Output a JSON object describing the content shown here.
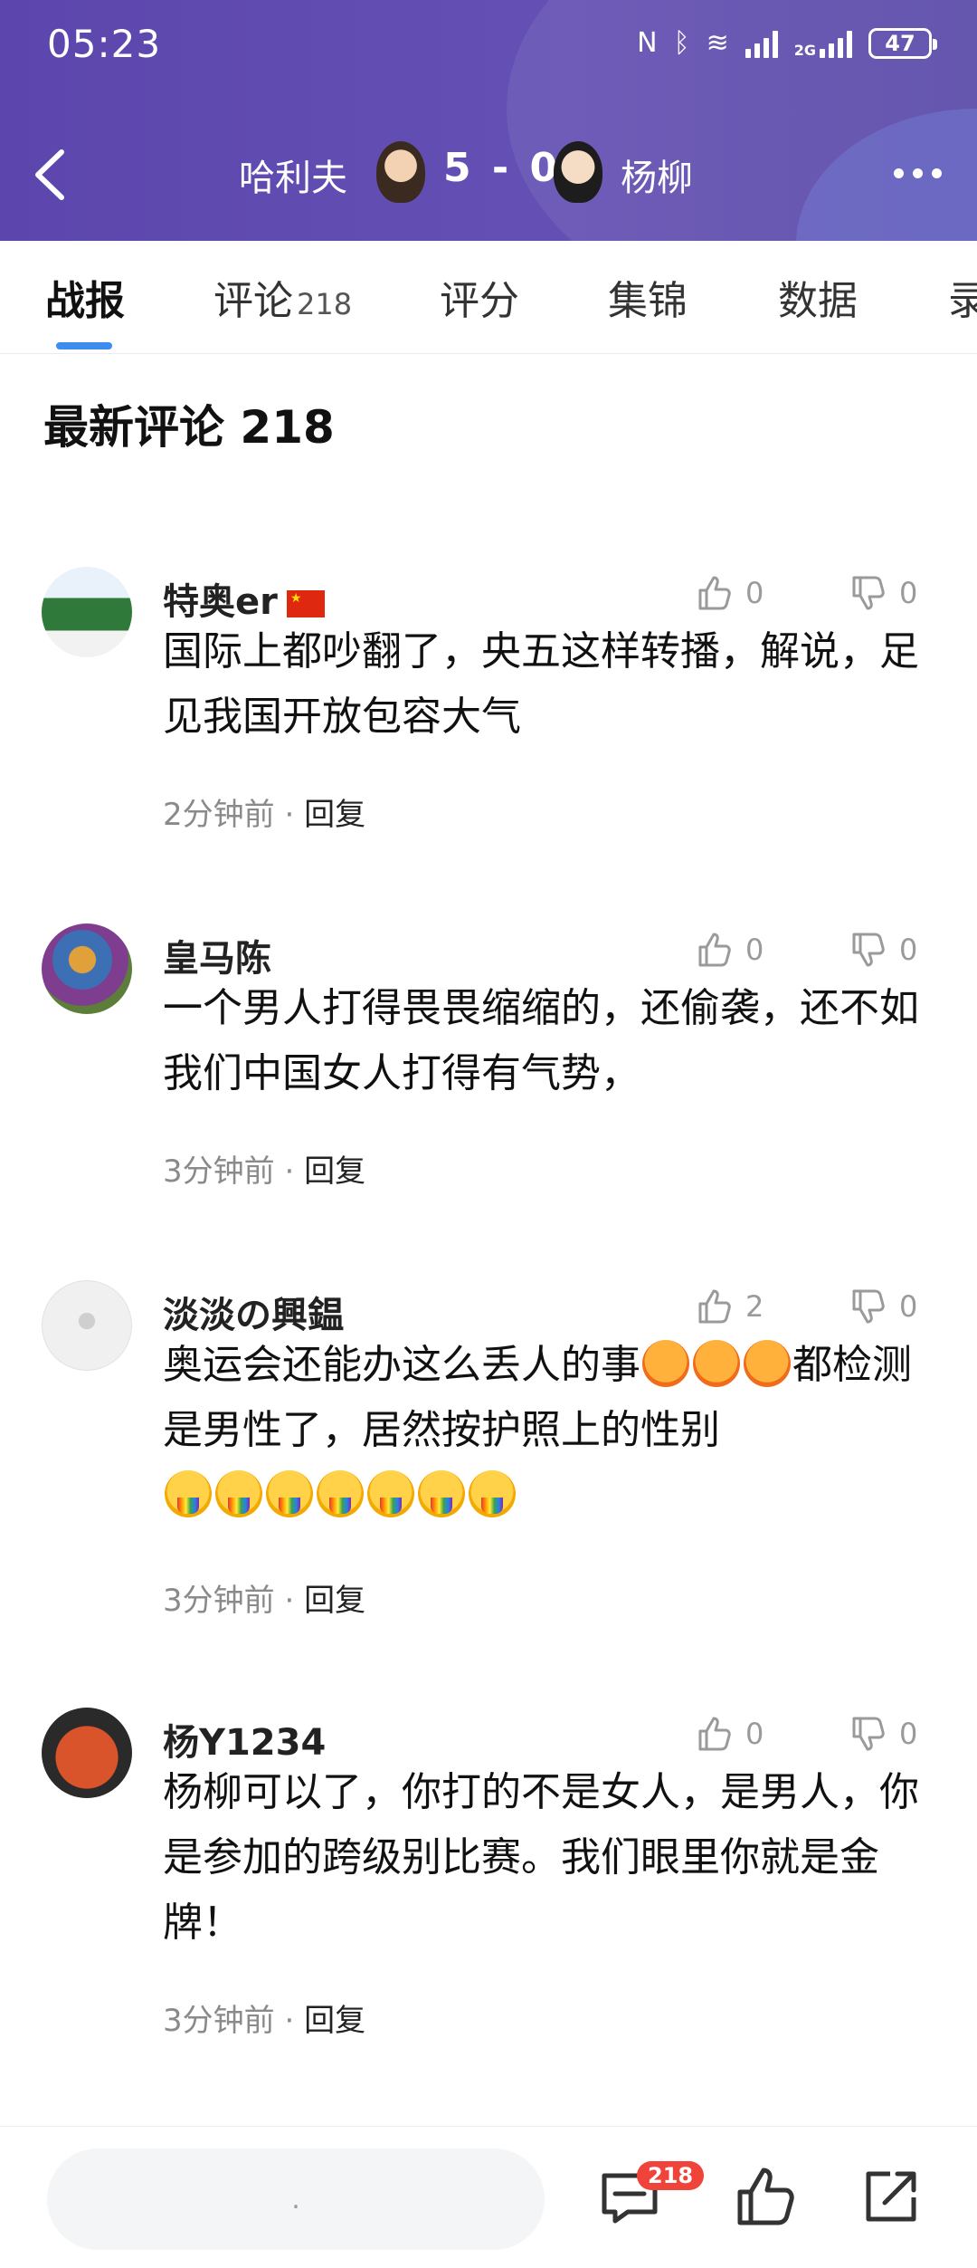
{
  "status_bar": {
    "time": "05:23",
    "network_1": "2G",
    "battery": "47"
  },
  "match": {
    "team_a": "哈利夫",
    "score": "5 - 0",
    "team_b": "杨柳"
  },
  "tabs": [
    {
      "label": "战报",
      "active": true
    },
    {
      "label": "评论",
      "count": "218",
      "active": false
    },
    {
      "label": "评分",
      "active": false
    },
    {
      "label": "集锦",
      "active": false
    },
    {
      "label": "数据",
      "active": false
    },
    {
      "label": "录",
      "active": false
    }
  ],
  "section": {
    "title": "最新评论 218"
  },
  "comments": [
    {
      "user": "特奥er",
      "flag": "cn-flag-icon",
      "text": "国际上都吵翻了，央五这样转播，解说，足见我国开放包容大气",
      "likes": "0",
      "dislikes": "0",
      "time": "2分钟前",
      "reply": "回复"
    },
    {
      "user": "皇马陈",
      "text": "一个男人打得畏畏缩缩的，还偷袭，还不如我们中国女人打得有气势，",
      "likes": "0",
      "dislikes": "0",
      "time": "3分钟前",
      "reply": "回复"
    },
    {
      "user": "淡淡の興鎾",
      "text_part1": "奥运会还能办这么丢人的事",
      "text_part2": "都检测是男性了，居然按护照上的性别",
      "likes": "2",
      "dislikes": "0",
      "time": "3分钟前",
      "reply": "回复"
    },
    {
      "user": "杨Y1234",
      "text": "杨柳可以了，你打的不是女人，是男人，你是参加的跨级别比赛。我们眼里你就是金牌！",
      "likes": "0",
      "dislikes": "0",
      "time": "3分钟前",
      "reply": "回复"
    }
  ],
  "bottom_bar": {
    "input_hint": ".",
    "comment_count": "218"
  },
  "colors": {
    "header": "#5c46ad",
    "tab_indicator": "#3e8cf0",
    "badge": "#f0433a"
  }
}
